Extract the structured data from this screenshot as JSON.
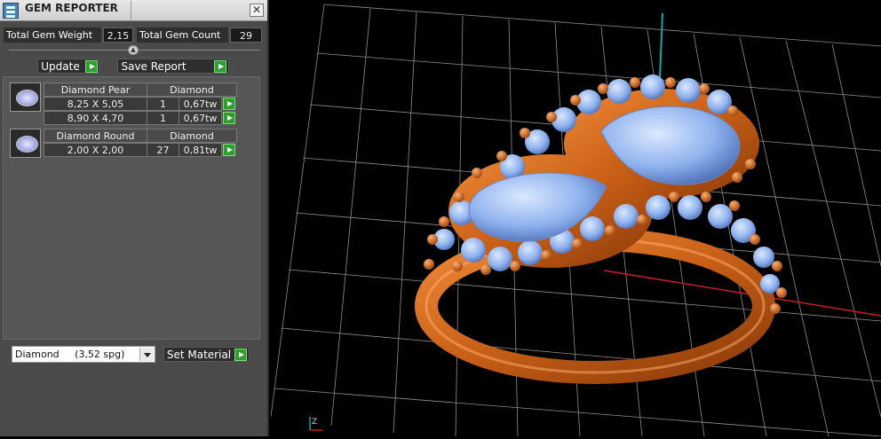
{
  "window": {
    "title": "GEM REPORTER",
    "close_label": "✕"
  },
  "summary": {
    "weight_label": "Total Gem Weight",
    "weight_value": "2,15",
    "count_label": "Total Gem Count",
    "count_value": "29"
  },
  "actions": {
    "update_label": "Update",
    "save_report_label": "Save Report",
    "collapse_icon": "chevron-up-icon"
  },
  "gems": [
    {
      "name": "Diamond Pear",
      "material": "Diamond",
      "shape_icon": "pear-gem-icon",
      "rows": [
        {
          "size": "8,25 X 5,05",
          "count": "1",
          "weight": "0,67tw"
        },
        {
          "size": "8,90 X 4,70",
          "count": "1",
          "weight": "0,67tw"
        }
      ]
    },
    {
      "name": "Diamond Round",
      "material": "Diamond",
      "shape_icon": "round-gem-icon",
      "rows": [
        {
          "size": "2,00 X 2,00",
          "count": "27",
          "weight": "0,81tw"
        }
      ]
    }
  ],
  "material": {
    "selected": "Diamond     (3,52 spg)",
    "set_label": "Set Material"
  },
  "viewport": {
    "axis_label": "Z",
    "colors": {
      "metal": "#d9691e",
      "gem": "#8fb6ef",
      "grid": "#bdbdbd",
      "x_axis": "#c81e1e",
      "z_axis": "#1aa6b0"
    }
  }
}
